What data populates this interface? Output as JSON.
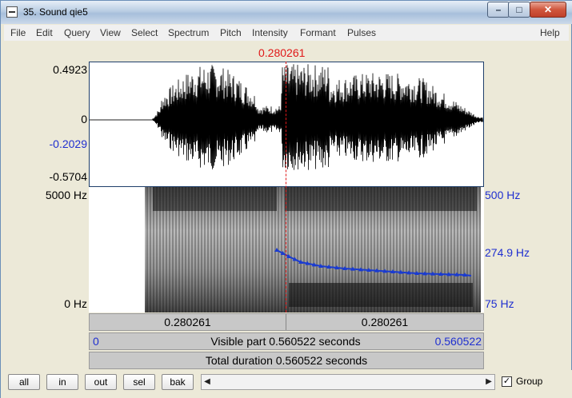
{
  "window": {
    "title": "35. Sound qie5",
    "min_label": "–",
    "max_label": "□",
    "close_label": "✕"
  },
  "menu": [
    "File",
    "Edit",
    "Query",
    "View",
    "Select",
    "Spectrum",
    "Pitch",
    "Intensity",
    "Formant",
    "Pulses",
    "Help"
  ],
  "cursor_time": "0.280261",
  "waveform": {
    "y_labels": [
      "0.4923",
      "0",
      "-0.2029",
      "-0.5704"
    ]
  },
  "spectrogram": {
    "left_labels": [
      "5000 Hz",
      "0 Hz"
    ],
    "right_labels": [
      "500 Hz",
      "274.9 Hz",
      "75 Hz"
    ]
  },
  "bars": {
    "left_time": "0.280261",
    "right_time": "0.280261",
    "visible_start": "0",
    "visible_text": "Visible part 0.560522 seconds",
    "visible_end": "0.560522",
    "total_text": "Total duration 0.560522 seconds"
  },
  "buttons": [
    "all",
    "in",
    "out",
    "sel",
    "bak"
  ],
  "group_label": "Group",
  "group_checked": true,
  "colors": {
    "cursor": "#e01818",
    "pitch": "#1a3bd0",
    "axis_blue": "#1f2fd0"
  }
}
